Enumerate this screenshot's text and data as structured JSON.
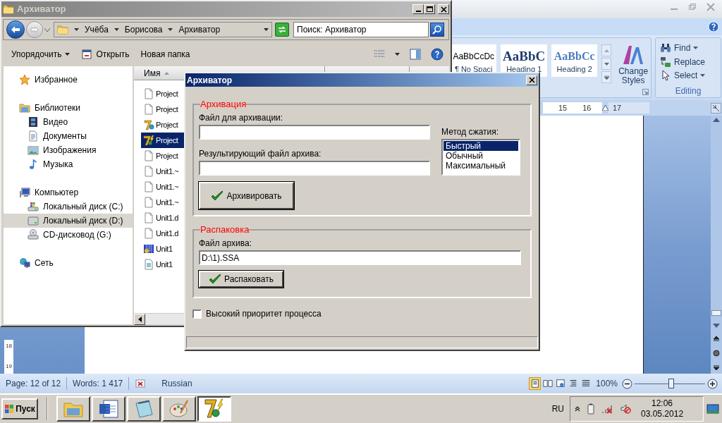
{
  "word": {
    "styles": [
      {
        "sample": "AaBbCcDc",
        "name": "¶ No Spaci",
        "kind": "plain"
      },
      {
        "sample": "AaBbC",
        "name": "Heading 1",
        "kind": "heading1"
      },
      {
        "sample": "AaBbCc",
        "name": "Heading 2",
        "kind": "heading2"
      }
    ],
    "change_styles": "Change Styles",
    "editing": {
      "title": "Editing",
      "items": [
        {
          "label": "Find",
          "kind": "find",
          "dropdown": true
        },
        {
          "label": "Replace",
          "kind": "replace",
          "dropdown": false
        },
        {
          "label": "Select",
          "kind": "select",
          "dropdown": true
        }
      ]
    },
    "ruler": [
      "15",
      "16",
      "17"
    ],
    "vertical_ruler": [
      "18",
      "19"
    ],
    "status": {
      "page": "Page: 12 of 12",
      "words": "Words: 1 417",
      "language": "Russian",
      "zoom": "100%",
      "zoom_slider": {
        "level": 0.52
      },
      "views": [
        {
          "kind": "print",
          "selected": true
        },
        {
          "kind": "reading",
          "selected": false
        },
        {
          "kind": "web",
          "selected": false
        },
        {
          "kind": "outline",
          "selected": false
        },
        {
          "kind": "draft",
          "selected": false
        }
      ]
    }
  },
  "explorer": {
    "title": "Архиватор",
    "breadcrumb": [
      "Учёба",
      "Борисова",
      "Архиватор"
    ],
    "search": {
      "placeholder": "Поиск: Архиватор"
    },
    "toolbar": [
      {
        "label": "Упорядочить",
        "kind": "organize",
        "dropdown": true
      },
      {
        "label": "Открыть",
        "kind": "open",
        "dropdown": false
      },
      {
        "label": "Новая папка",
        "kind": "new-folder",
        "dropdown": false
      }
    ],
    "nav": [
      {
        "label": "Избранное",
        "kind": "star",
        "selected": false
      },
      {
        "label": "Библиотеки",
        "kind": "library",
        "selected": false,
        "children": [
          {
            "label": "Видео",
            "kind": "video",
            "selected": false
          },
          {
            "label": "Документы",
            "kind": "document",
            "selected": false
          },
          {
            "label": "Изображения",
            "kind": "image",
            "selected": false
          },
          {
            "label": "Музыка",
            "kind": "music",
            "selected": false
          }
        ]
      },
      {
        "label": "Компьютер",
        "kind": "computer",
        "selected": false,
        "children": [
          {
            "label": "Локальный диск (C:)",
            "kind": "system-disk",
            "selected": false
          },
          {
            "label": "Локальный диск (D:)",
            "kind": "disk",
            "selected": true
          },
          {
            "label": "CD-дисковод (G:)",
            "kind": "cd",
            "selected": false
          }
        ]
      },
      {
        "label": "Сеть",
        "kind": "network",
        "selected": false
      }
    ],
    "columns": [
      "Имя"
    ],
    "files": [
      {
        "name": "Project",
        "kind": "blank",
        "selected": false
      },
      {
        "name": "Project",
        "kind": "blank",
        "selected": false
      },
      {
        "name": "Project",
        "kind": "project",
        "selected": false
      },
      {
        "name": "Project",
        "kind": "app",
        "selected": true
      },
      {
        "name": "Project",
        "kind": "blank",
        "selected": false
      },
      {
        "name": "Unit1.~",
        "kind": "blank",
        "selected": false
      },
      {
        "name": "Unit1.~",
        "kind": "blank",
        "selected": false
      },
      {
        "name": "Unit1.~",
        "kind": "blank",
        "selected": false
      },
      {
        "name": "Unit1.d",
        "kind": "blank",
        "selected": false
      },
      {
        "name": "Unit1.d",
        "kind": "blank",
        "selected": false
      },
      {
        "name": "Unit1",
        "kind": "source",
        "selected": false
      },
      {
        "name": "Unit1",
        "kind": "form",
        "selected": false
      }
    ]
  },
  "dialog": {
    "title": "Архиватор",
    "archive_group": {
      "title": "Архивация",
      "source_label": "Файл для архивации:",
      "result_label": "Результирующий файл архива:",
      "method_label": "Метод сжатия:",
      "methods": [
        {
          "label": "Быстрый",
          "selected": true
        },
        {
          "label": "Обычный",
          "selected": false
        },
        {
          "label": "Максимальный",
          "selected": false
        }
      ],
      "button": "Архивировать"
    },
    "extract_group": {
      "title": "Распаковка",
      "file_label": "Файл архива:",
      "file_value": "D:\\1).SSA",
      "button": "Распаковать"
    },
    "high_priority": {
      "label": "Высокий приоритет процесса",
      "checked": false
    }
  },
  "taskbar": {
    "start": "Пуск",
    "apps": [
      {
        "kind": "explorer",
        "selected": false
      },
      {
        "kind": "word",
        "selected": false
      },
      {
        "kind": "notepad",
        "selected": false
      },
      {
        "kind": "paint",
        "selected": false
      },
      {
        "kind": "app",
        "selected": true
      }
    ],
    "language": "RU",
    "time": "12:06",
    "date": "03.05.2012"
  }
}
